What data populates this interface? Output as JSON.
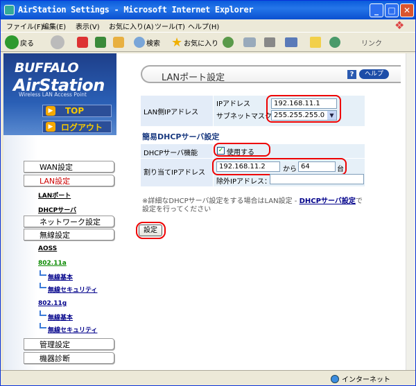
{
  "window": {
    "title": "AirStation Settings - Microsoft Internet Explorer"
  },
  "menu": [
    "ファイル(F)",
    "編集(E)",
    "表示(V)",
    "お気に入り(A)",
    "ツール(T)",
    "ヘルプ(H)"
  ],
  "toolbar": {
    "back": "戻る",
    "search": "検索",
    "favorites": "お気に入り",
    "links": "リンク"
  },
  "statusbar": {
    "zone": "インターネット"
  },
  "sidebar": {
    "brand": "BUFFALO",
    "product": "AirStation",
    "tagline": "Wireless LAN Access Point",
    "top_button": "TOP",
    "logout_button": "ログアウト",
    "wan": "WAN設定",
    "lan": "LAN設定",
    "lan_port": "LANポート",
    "dhcp_server": "DHCPサーバ",
    "network": "ネットワーク設定",
    "wireless": "無線設定",
    "aoss": "AOSS",
    "band_a": "802.11a",
    "band_a_basic": "無線基本",
    "band_a_security": "無線セキュリティ",
    "band_g": "802.11g",
    "band_g_basic": "無線基本",
    "band_g_security": "無線セキュリティ",
    "admin": "管理設定",
    "diagnostics": "機器診断"
  },
  "page": {
    "title": "LANポート設定",
    "help": "ヘルプ",
    "lan_ip_label": "LAN側IPアドレス",
    "ip_label": "IPアドレス",
    "ip_value": "192.168.11.1",
    "subnet_label": "サブネットマスク",
    "subnet_value": "255.255.255.0",
    "dhcp_section": "簡易DHCPサーバ設定",
    "dhcp_func_label": "DHCPサーバ機能",
    "dhcp_enable_label": "使用する",
    "assign_label": "割り当てIPアドレス",
    "assign_start": "192.168.11.2",
    "from_label": "から",
    "assign_count": "64",
    "count_unit": "台",
    "exclude_label": "除外IPアドレス：",
    "exclude_value": "",
    "note_line1": "※詳細なDHCPサーバ設定をする場合はLAN設定 - ",
    "note_link": "DHCPサーバ設定",
    "note_line1_tail": "で",
    "note_line2": "設定を行ってください",
    "submit": "設定"
  }
}
